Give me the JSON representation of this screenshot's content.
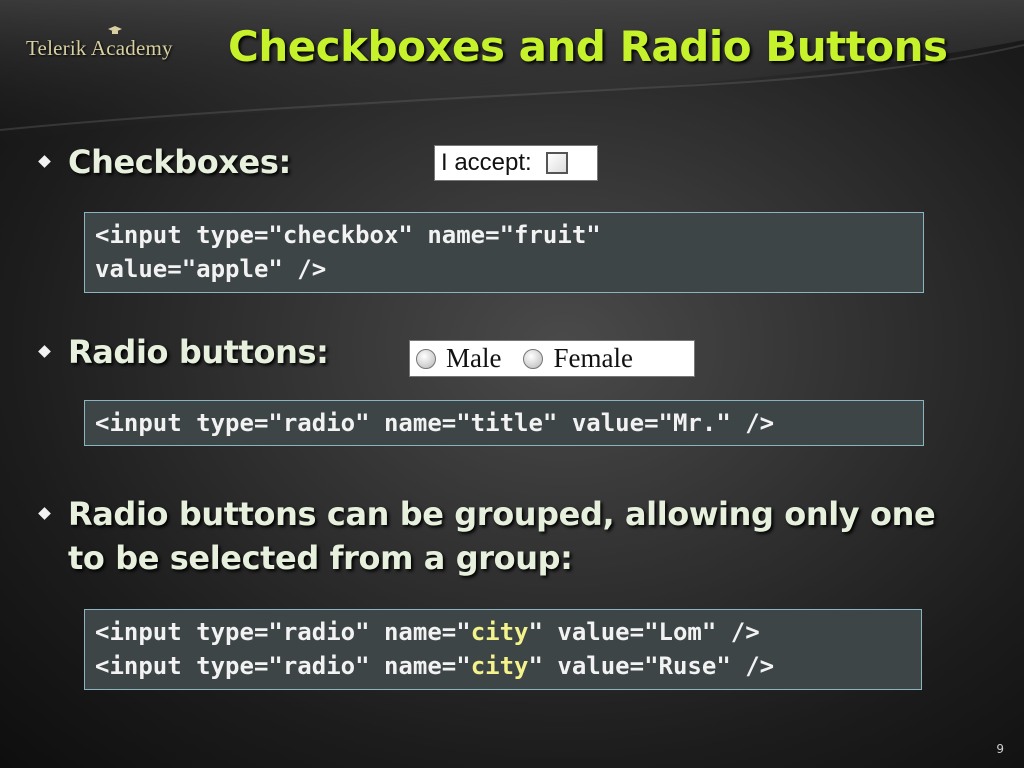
{
  "slide": {
    "logo": "Telerik Academy",
    "title": "Checkboxes and Radio Buttons",
    "page_number": "9"
  },
  "bullets": [
    {
      "text": "Checkboxes:"
    },
    {
      "text": "Radio buttons:"
    },
    {
      "text": "Radio buttons can be grouped, allowing only one to be selected from a group:"
    }
  ],
  "checkbox_demo": {
    "label": "I accept:",
    "checked": false
  },
  "radio_demo": {
    "options": [
      "Male",
      "Female"
    ],
    "selected": null
  },
  "code": {
    "checkbox": {
      "line1": "<input type=\"checkbox\" name=\"fruit\"",
      "line2": "value=\"apple\" />"
    },
    "radio": {
      "line1": "<input type=\"radio\" name=\"title\" value=\"Mr.\" />"
    },
    "group": {
      "line1_a": "<input type=\"radio\" name=\"",
      "line1_hl": "city",
      "line1_b": "\" value=\"Lom\" />",
      "line2_a": "<input type=\"radio\" name=\"",
      "line2_hl": "city",
      "line2_b": "\" value=\"Ruse\" />"
    }
  },
  "colors": {
    "title": "#c6f22c",
    "bullet_text": "#e6f0dc",
    "code_highlight": "#f4f28a",
    "code_border": "#8ab4c0"
  }
}
